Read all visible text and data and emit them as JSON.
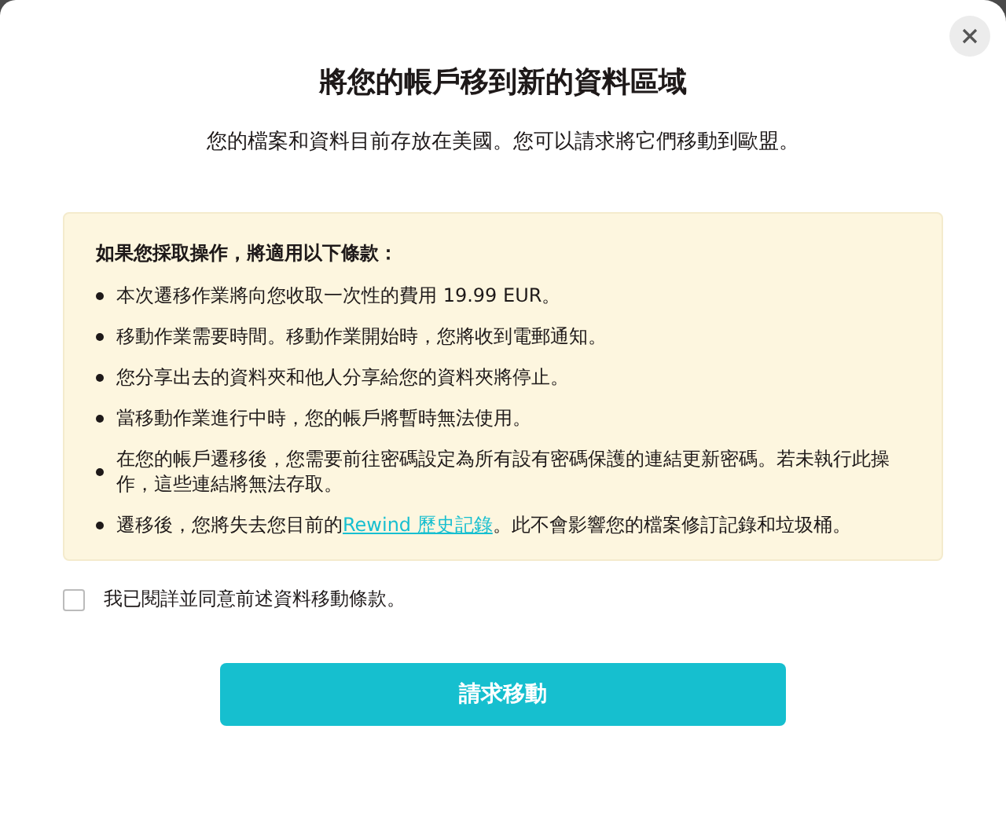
{
  "dialog": {
    "title": "將您的帳戶移到新的資料區域",
    "subtitle": "您的檔案和資料目前存放在美國。您可以請求將它們移動到歐盟。"
  },
  "terms": {
    "heading": "如果您採取操作，將適用以下條款：",
    "items": [
      {
        "kind": "text",
        "text": "本次遷移作業將向您收取一次性的費用 19.99 EUR。"
      },
      {
        "kind": "text",
        "text": "移動作業需要時間。移動作業開始時，您將收到電郵通知。"
      },
      {
        "kind": "text",
        "text": "您分享出去的資料夾和他人分享給您的資料夾將停止。"
      },
      {
        "kind": "text",
        "text": "當移動作業進行中時，您的帳戶將暫時無法使用。"
      },
      {
        "kind": "text",
        "text": "在您的帳戶遷移後，您需要前往密碼設定為所有設有密碼保護的連結更新密碼。若未執行此操作，這些連結將無法存取。"
      },
      {
        "kind": "link",
        "before": "遷移後，您將失去您目前的",
        "link": "Rewind 歷史記錄",
        "after": "。此不會影響您的檔案修訂記錄和垃圾桶。"
      }
    ]
  },
  "agreement": {
    "label": "我已閱詳並同意前述資料移動條款。",
    "checked": false
  },
  "button": "請求移動"
}
